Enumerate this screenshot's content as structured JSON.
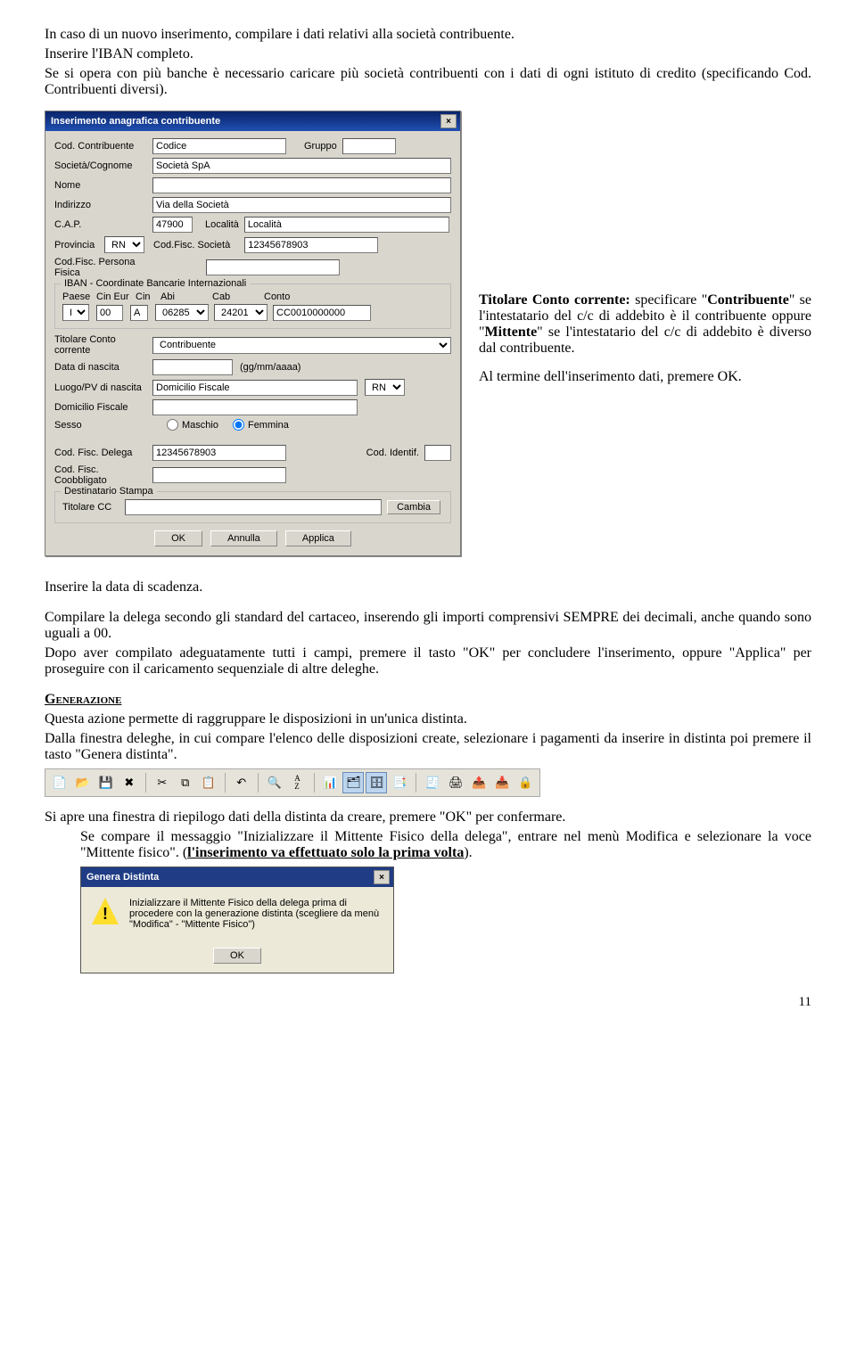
{
  "intro": {
    "p1": "In caso di un nuovo inserimento, compilare i dati relativi alla società contribuente.",
    "p2": "Inserire l'IBAN completo.",
    "p3": "Se si opera con più banche è necessario caricare più società contribuenti con i dati di ogni istituto di credito (specificando Cod. Contribuenti diversi)."
  },
  "dialog": {
    "title": "Inserimento anagrafica contribuente",
    "close": "×",
    "labels": {
      "codContribuente": "Cod. Contribuente",
      "gruppo": "Gruppo",
      "societa": "Società/Cognome",
      "nome": "Nome",
      "indirizzo": "Indirizzo",
      "cap": "C.A.P.",
      "localita": "Località",
      "provincia": "Provincia",
      "cfSocieta": "Cod.Fisc. Società",
      "cfPersona": "Cod.Fisc. Persona Fisica",
      "ibanGroup": "IBAN - Coordinate Bancarie Internazionali",
      "paese": "Paese",
      "cinEur": "Cin Eur",
      "cin": "Cin",
      "abi": "Abi",
      "cab": "Cab",
      "conto": "Conto",
      "titolare": "Titolare Conto corrente",
      "dataNascita": "Data di nascita",
      "dateHint": "(gg/mm/aaaa)",
      "luogoPV": "Luogo/PV di nascita",
      "domicilio": "Domicilio Fiscale",
      "sesso": "Sesso",
      "maschio": "Maschio",
      "femmina": "Femmina",
      "cfDelega": "Cod. Fisc. Delega",
      "codIdentif": "Cod. Identif.",
      "cfCoobbligato": "Cod. Fisc. Coobbligato",
      "destStampaGroup": "Destinatario Stampa",
      "titolareCC": "Titolare CC",
      "cambia": "Cambia"
    },
    "values": {
      "codContribuente": "Codice",
      "gruppo": "",
      "societa": "Società SpA",
      "nome": "",
      "indirizzo": "Via della Società",
      "cap": "47900",
      "localita": "Località",
      "provincia": "RN",
      "cfSocieta": "12345678903",
      "cfPersona": "",
      "paese": "IT",
      "cinEur": "00",
      "cin": "A",
      "abi": "06285",
      "cab": "24201",
      "conto": "CC0010000000",
      "titolare": "Contribuente",
      "dataNascita": "",
      "luogo": "Domicilio Fiscale",
      "pvNascita": "RN",
      "domicilio": "",
      "cfDelega": "12345678903",
      "codIdentif": "",
      "cfCoobbligato": "",
      "destTitolareCC": ""
    },
    "buttons": {
      "ok": "OK",
      "annulla": "Annulla",
      "applica": "Applica"
    }
  },
  "rightCol": {
    "p1a": "Titolare Conto corrente:",
    "p1b": " specificare \"",
    "p1c": "Contribuente",
    "p1d": "\" se l'intestatario del c/c di addebito è il contribuente oppure \"",
    "p1e": "Mittente",
    "p1f": "\" se l'intestatario del c/c di addebito è diverso dal contribuente.",
    "p2": "Al termine dell'inserimento dati, premere OK."
  },
  "body2": {
    "p1": "Inserire la data di scadenza.",
    "p2": "Compilare la delega secondo gli standard del cartaceo, inserendo gli importi comprensivi SEMPRE dei decimali, anche quando sono uguali a 00.",
    "p3": "Dopo aver compilato adeguatamente tutti i campi, premere il tasto \"OK\" per concludere l'inserimento, oppure \"Applica\" per proseguire con il caricamento sequenziale di altre deleghe.",
    "genTitle": "Generazione",
    "gen1": "Questa azione permette di raggruppare le disposizioni in un'unica distinta.",
    "gen2": "Dalla finestra deleghe, in cui compare l'elenco delle disposizioni create, selezionare i pagamenti da inserire in distinta poi premere il tasto \"Genera distinta\"."
  },
  "toolbarIcons": [
    "new-icon",
    "open-icon",
    "save-icon",
    "delete-icon",
    "cut-icon",
    "copy-icon",
    "paste-icon",
    "undo-icon",
    "find-icon",
    "sort-icon",
    "filter-icon",
    "form1-icon",
    "form2-icon",
    "report-icon",
    "genera-distinta-icon",
    "print-icon",
    "export-icon",
    "import-icon",
    "lock-icon"
  ],
  "afterToolbar": {
    "p1": "Si apre una finestra di  riepilogo dati della distinta da creare, premere \"OK\" per confermare.",
    "p2a": "Se compare il messaggio \"Inizializzare il Mittente Fisico della delega\", entrare nel menù Modifica e selezionare la voce \"Mittente fisico\". (",
    "p2b": "l'inserimento va effettuato solo la prima volta",
    "p2c": ")."
  },
  "msgbox": {
    "title": "Genera Distinta",
    "close": "×",
    "text": "Inizializzare il Mittente Fisico della delega prima di procedere con la generazione distinta (scegliere da menù \"Modifica\" - \"Mittente Fisico\")",
    "ok": "OK"
  },
  "pageNumber": "11"
}
